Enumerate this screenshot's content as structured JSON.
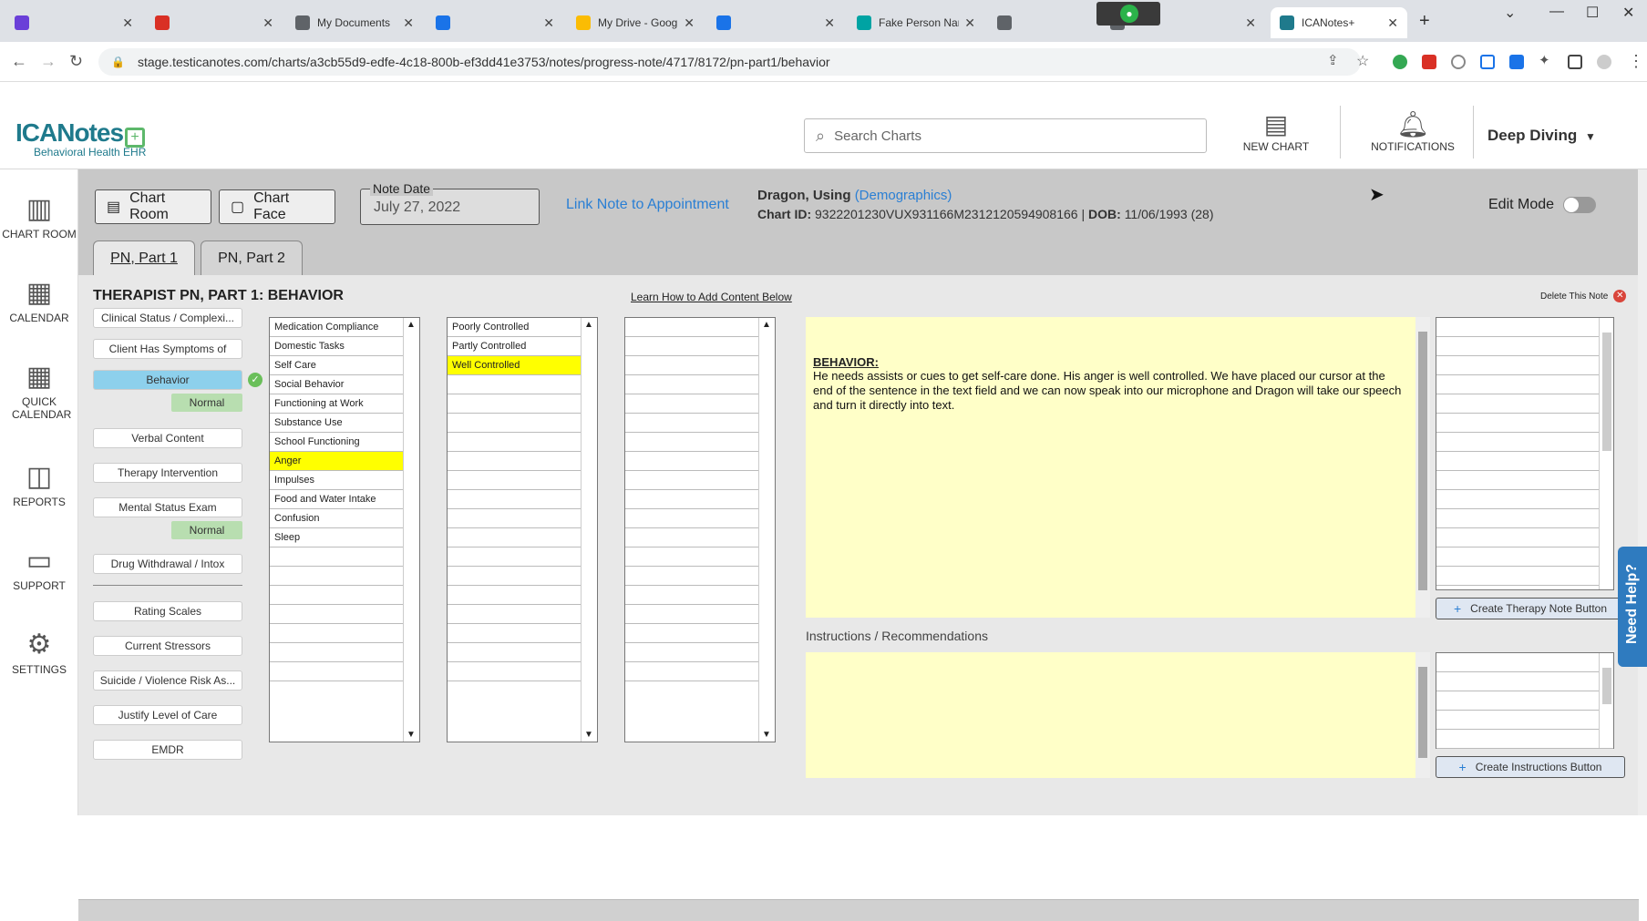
{
  "browser": {
    "tabs": [
      {
        "title": "",
        "color": "#6a3fd8"
      },
      {
        "title": "",
        "color": "#d93025"
      },
      {
        "title": "My Documents",
        "color": "#5f6368"
      },
      {
        "title": "",
        "color": "#1a73e8"
      },
      {
        "title": "My Drive - Goog",
        "color": "#fbbc04"
      },
      {
        "title": "",
        "color": "#1a73e8"
      },
      {
        "title": "Fake Person Nam",
        "color": "#00a3a3"
      },
      {
        "title": "",
        "color": "#5f6368"
      },
      {
        "title": "",
        "color": "#5f6368"
      },
      {
        "title": "ICANotes+",
        "color": "#1f7a8c"
      }
    ],
    "url": "stage.testicanotes.com/charts/a3cb55d9-edfe-4c18-800b-ef3dd41e3753/notes/progress-note/4717/8172/pn-part1/behavior"
  },
  "header": {
    "brand": "ICANotes",
    "tagline": "Behavioral Health EHR",
    "search_placeholder": "Search Charts",
    "new_chart": "NEW CHART",
    "notifications": "NOTIFICATIONS",
    "user": "Deep Diving"
  },
  "leftnav": [
    {
      "label": "CHART ROOM",
      "icon": "chart-room-icon"
    },
    {
      "label": "CALENDAR",
      "icon": "calendar-icon"
    },
    {
      "label": "QUICK CALENDAR",
      "icon": "quick-calendar-icon"
    },
    {
      "label": "REPORTS",
      "icon": "reports-icon"
    },
    {
      "label": "SUPPORT",
      "icon": "support-icon"
    },
    {
      "label": "SETTINGS",
      "icon": "settings-icon"
    }
  ],
  "toolbar": {
    "chart_room": "Chart Room",
    "chart_face": "Chart Face",
    "note_date_label": "Note Date",
    "note_date": "July 27, 2022",
    "link_note": "Link Note to Appointment",
    "edit_mode": "Edit Mode"
  },
  "patient": {
    "name": "Dragon, Using",
    "demographics": "(Demographics)",
    "chart_id_label": "Chart ID:",
    "chart_id": "9322201230VUX931166M2312120594908166",
    "dob_label": "DOB:",
    "dob": "11/06/1993 (28)"
  },
  "tabs": [
    "PN, Part 1",
    "PN, Part 2"
  ],
  "panel": {
    "title": "THERAPIST PN, PART 1: BEHAVIOR",
    "learn": "Learn How to Add Content Below",
    "delete": "Delete This Note"
  },
  "sections": {
    "clinical_status": "Clinical Status / Complexi...",
    "symptoms": "Client Has Symptoms of",
    "behavior": "Behavior",
    "normal": "Normal",
    "verbal": "Verbal Content",
    "therapy": "Therapy Intervention",
    "mse": "Mental Status Exam",
    "drug": "Drug Withdrawal / Intox",
    "rating": "Rating Scales",
    "stressors": "Current Stressors",
    "suicide": "Suicide / Violence Risk As...",
    "justify": "Justify Level of Care",
    "emdr": "EMDR"
  },
  "list1": [
    "Medication Compliance",
    "Domestic Tasks",
    "Self Care",
    "Social Behavior",
    "Functioning at Work",
    "Substance Use",
    "School Functioning",
    "Anger",
    "Impulses",
    "Food and Water Intake",
    "Confusion",
    "Sleep"
  ],
  "list2": [
    "Poorly Controlled",
    "Partly Controlled",
    "Well Controlled"
  ],
  "note": {
    "title": "BEHAVIOR:",
    "text": "He needs assists or cues to get self-care done. His anger is well controlled. We have placed our cursor at the end of the sentence in the text field and we can now speak into our microphone and Dragon will take our speech and turn it directly into text."
  },
  "instructions_label": "Instructions / Recommendations",
  "create_therapy": "Create Therapy Note Button",
  "create_instructions": "Create Instructions Button",
  "need_help": "Need Help?"
}
